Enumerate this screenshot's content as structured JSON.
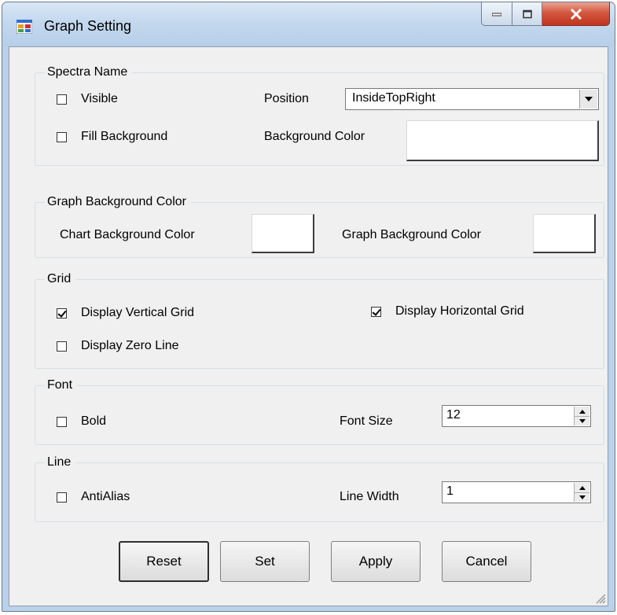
{
  "window": {
    "title": "Graph Setting"
  },
  "spectra_name": {
    "legend": "Spectra Name",
    "visible_label": "Visible",
    "visible_checked": false,
    "position_label": "Position",
    "position_value": "InsideTopRight",
    "fill_background_label": "Fill Background",
    "fill_background_checked": false,
    "background_color_label": "Background Color"
  },
  "graph_bg": {
    "legend": "Graph Background Color",
    "chart_bg_label": "Chart Background Color",
    "graph_bg_label": "Graph Background Color"
  },
  "grid": {
    "legend": "Grid",
    "vertical_label": "Display Vertical Grid",
    "vertical_checked": true,
    "horizontal_label": "Display Horizontal Grid",
    "horizontal_checked": true,
    "zero_line_label": "Display Zero Line",
    "zero_line_checked": false
  },
  "font": {
    "legend": "Font",
    "bold_label": "Bold",
    "bold_checked": false,
    "size_label": "Font Size",
    "size_value": "12"
  },
  "line": {
    "legend": "Line",
    "antialias_label": "AntiAlias",
    "antialias_checked": false,
    "width_label": "Line Width",
    "width_value": "1"
  },
  "buttons": {
    "reset": "Reset",
    "set": "Set",
    "apply": "Apply",
    "cancel": "Cancel"
  }
}
